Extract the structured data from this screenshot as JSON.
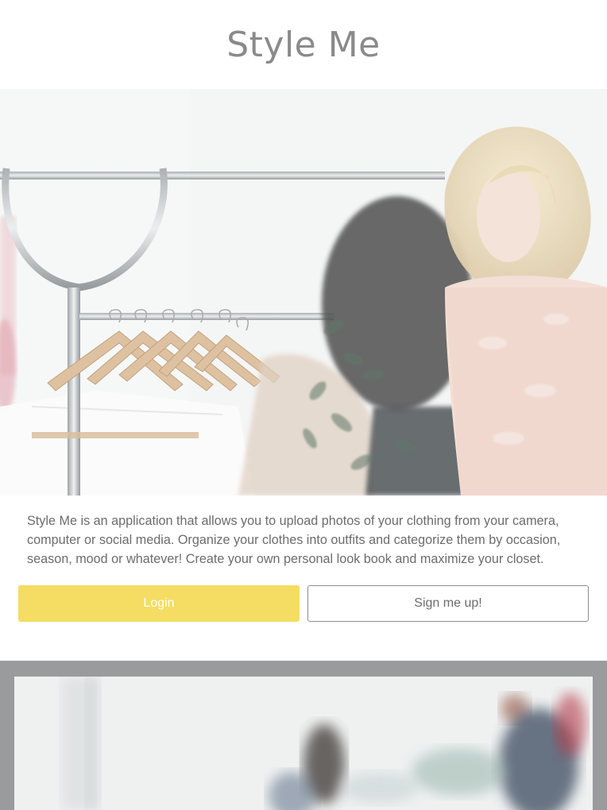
{
  "header": {
    "title": "Style Me"
  },
  "hero": {
    "image_description_icon": "clothing-rack-hero-image"
  },
  "intro": {
    "description": "Style Me is an application that allows you to upload photos of your clothing from your camera, computer or social media. Organize your clothes into outfits and categorize them by occasion, season, mood or whatever! Create your own personal look book and maximize your closet."
  },
  "actions": {
    "login_label": "Login",
    "signup_label": "Sign me up!"
  },
  "colors": {
    "login_bg": "#f4dd62",
    "gallery_bg": "#9a9b9d",
    "title": "#8a8a8a"
  }
}
